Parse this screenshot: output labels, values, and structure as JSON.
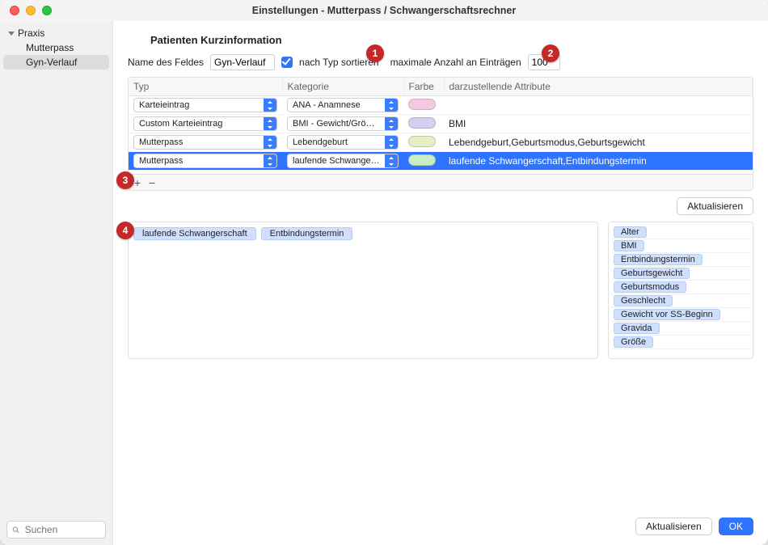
{
  "window": {
    "title": "Einstellungen - Mutterpass / Schwangerschaftsrechner"
  },
  "sidebar": {
    "root": "Praxis",
    "items": [
      "Mutterpass",
      "Gyn-Verlauf"
    ],
    "selected_index": 1,
    "search_placeholder": "Suchen"
  },
  "section": {
    "title": "Patienten Kurzinformation"
  },
  "field": {
    "name_label": "Name des Feldes",
    "name_value": "Gyn-Verlauf",
    "sort_label": "nach Typ sortieren",
    "sort_checked": true,
    "max_label": "maximale Anzahl an Einträgen",
    "max_value": "100"
  },
  "table": {
    "headers": [
      "Typ",
      "Kategorie",
      "Farbe",
      "darzustellende Attribute"
    ],
    "rows": [
      {
        "typ": "Karteieintrag",
        "kat": "ANA - Anamnese",
        "color": "#f3c9e0",
        "attr": ""
      },
      {
        "typ": "Custom Karteieintrag",
        "kat": "BMI - Gewicht/Größe/...",
        "color": "#d4cfee",
        "attr": "BMI"
      },
      {
        "typ": "Mutterpass",
        "kat": "Lebendgeburt",
        "color": "#e6eec4",
        "attr": "Lebendgeburt,Geburtsmodus,Geburtsgewicht"
      },
      {
        "typ": "Mutterpass",
        "kat": "laufende Schwangers...",
        "color": "#c9eec4",
        "attr": "laufende Schwangerschaft,Entbindungstermin",
        "selected": true
      }
    ]
  },
  "buttons": {
    "add": "+",
    "remove": "−",
    "aktualisieren": "Aktualisieren",
    "ok": "OK"
  },
  "selected_tokens": [
    "laufende Schwangerschaft",
    "Entbindungstermin"
  ],
  "available_attributes": [
    "Alter",
    "BMI",
    "Entbindungstermin",
    "Geburtsgewicht",
    "Geburtsmodus",
    "Geschlecht",
    "Gewicht vor SS-Beginn",
    "Gravida",
    "Größe"
  ],
  "callouts": {
    "c1": "1",
    "c2": "2",
    "c3": "3",
    "c4": "4"
  }
}
